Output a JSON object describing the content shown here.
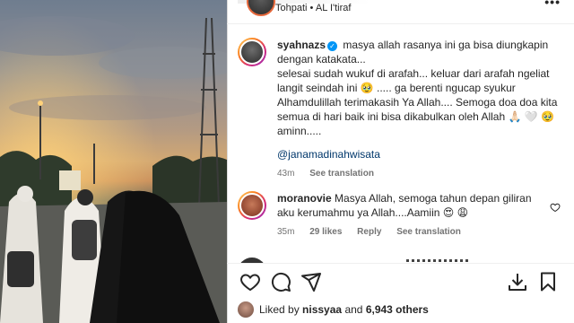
{
  "post": {
    "location_user": "Tohpati",
    "location_sep": "•",
    "location_name": "AL I'tiraf"
  },
  "caption": {
    "username": "syahnazs",
    "line1": "masya allah rasanya ini ga bisa diungkapin dengan katakata...",
    "line2": "selesai sudah wukuf di arafah... keluar dari arafah ngeliat langit seindah ini 🥹 ..... ga berenti ngucap syukur Alhamdulillah terimakasih Ya Allah.... Semoga doa doa kita semua di hari baik ini bisa dikabulkan oleh Allah 🙏🏻 🤍 🥹 aminn.....",
    "mention": "@janamadinahwisata",
    "time": "43m",
    "see_translation": "See translation"
  },
  "comments": [
    {
      "username": "moranovie",
      "text": "Masya Allah, semoga tahun depan giliran aku kerumahmu ya Allah....Aamiin 😍 😩",
      "time": "35m",
      "likes": "29 likes",
      "reply": "Reply",
      "see_translation": "See translation"
    }
  ],
  "likes": {
    "prefix": "Liked by",
    "user": "nissyaa",
    "and": "and",
    "others": "6,943 others"
  },
  "icons": [
    "heart-icon",
    "comment-icon",
    "share-icon",
    "download-icon",
    "bookmark-icon",
    "more-icon",
    "verified-icon",
    "like-comment-icon"
  ],
  "colors": {
    "link": "#00376b",
    "verified": "#0095f6",
    "meta": "#737373"
  }
}
